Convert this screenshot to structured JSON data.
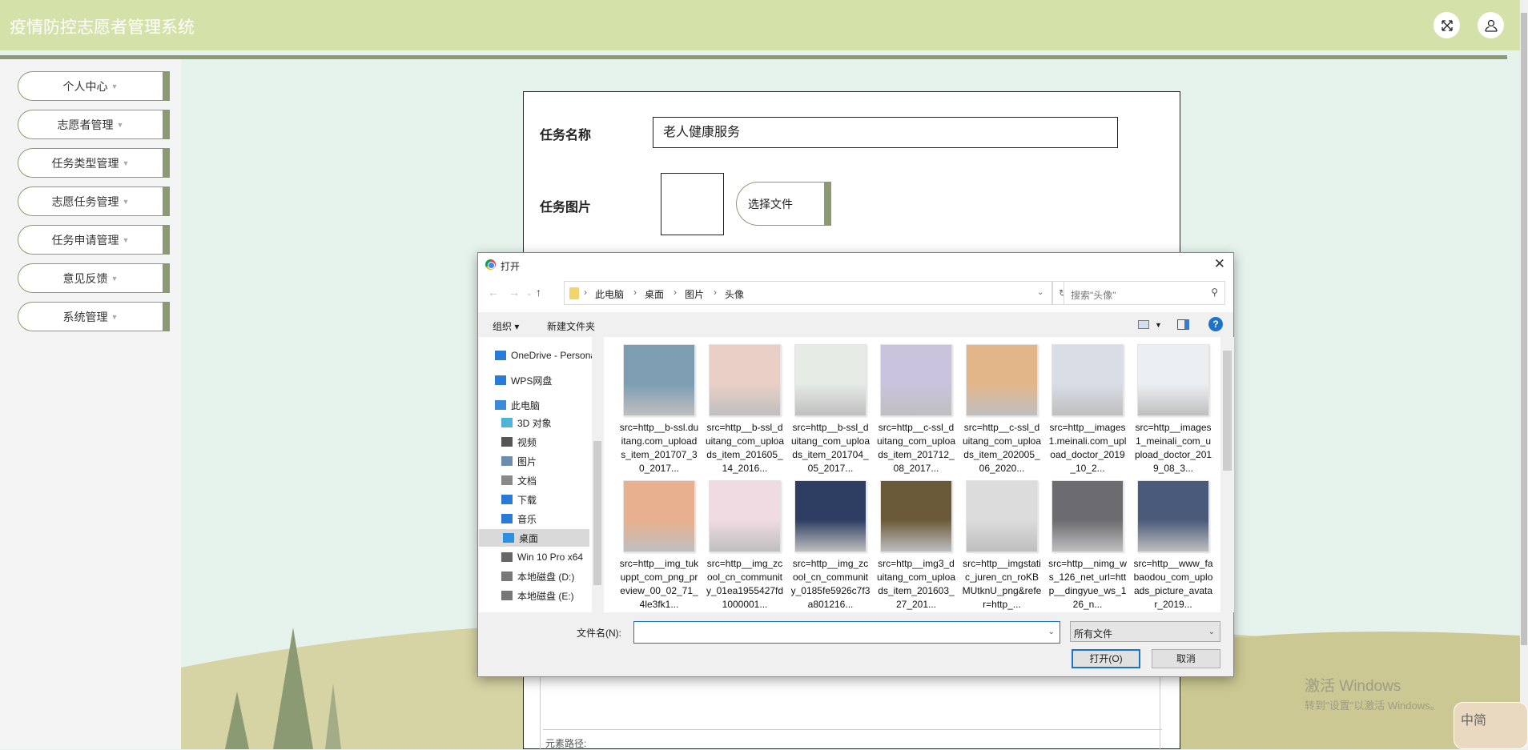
{
  "header": {
    "title": "疫情防控志愿者管理系统",
    "fullscreen_icon": "fullscreen-icon",
    "user_icon": "user-icon"
  },
  "sidebar": {
    "items": [
      {
        "label": "个人中心"
      },
      {
        "label": "志愿者管理"
      },
      {
        "label": "任务类型管理"
      },
      {
        "label": "志愿任务管理"
      },
      {
        "label": "任务申请管理"
      },
      {
        "label": "意见反馈"
      },
      {
        "label": "系统管理"
      }
    ]
  },
  "form": {
    "task_name_label": "任务名称",
    "task_name_value": "老人健康服务",
    "task_image_label": "任务图片",
    "choose_file_label": "选择文件",
    "element_path_label": "元素路径:"
  },
  "dialog": {
    "title": "打开",
    "breadcrumb": [
      "此电脑",
      "桌面",
      "图片",
      "头像"
    ],
    "search_placeholder": "搜索\"头像\"",
    "organize_label": "组织 ▾",
    "new_folder_label": "新建文件夹",
    "nav_items": [
      {
        "label": "OneDrive - Personal"
      },
      {
        "label": "WPS网盘"
      },
      {
        "label": "此电脑"
      },
      {
        "label": "3D 对象"
      },
      {
        "label": "视频"
      },
      {
        "label": "图片"
      },
      {
        "label": "文档"
      },
      {
        "label": "下载"
      },
      {
        "label": "音乐"
      },
      {
        "label": "桌面"
      },
      {
        "label": "Win 10 Pro x64"
      },
      {
        "label": "本地磁盘 (D:)"
      },
      {
        "label": "本地磁盘 (E:)"
      }
    ],
    "files": [
      {
        "name": "src=http__b-ssl.duitang.com_uploads_item_201707_30_2017...",
        "color": "#7d9db3"
      },
      {
        "name": "src=http__b-ssl_duitang_com_uploads_item_201605_14_2016...",
        "color": "#e9cfc6"
      },
      {
        "name": "src=http__b-ssl_duitang_com_uploads_item_201704_05_2017...",
        "color": "#e6ebe6"
      },
      {
        "name": "src=http__c-ssl_duitang_com_uploads_item_201712_08_2017...",
        "color": "#c9c3dd"
      },
      {
        "name": "src=http__c-ssl_duitang_com_uploads_item_202005_06_2020...",
        "color": "#e3b68a"
      },
      {
        "name": "src=http__images1.meinali.com_upload_doctor_2019_10_2...",
        "color": "#d9dde6"
      },
      {
        "name": "src=http__images1_meinali_com_upload_doctor_2019_08_3...",
        "color": "#eceff2"
      },
      {
        "name": "src=http__img_tukuppt_com_png_preview_00_02_71_4le3fk1...",
        "color": "#e8b08e"
      },
      {
        "name": "src=http__img_zcool_cn_community_01ea1955427fd1000001...",
        "color": "#f0dbe3"
      },
      {
        "name": "src=http__img_zcool_cn_community_0185fe5926c7f3a801216...",
        "color": "#2e3e63"
      },
      {
        "name": "src=http__img3_duitang_com_uploads_item_201603_27_201...",
        "color": "#6b5a3a"
      },
      {
        "name": "src=http__imgstatic_juren_cn_roKBMUtknU_png&refer=http_...",
        "color": "#dcdcdc"
      },
      {
        "name": "src=http__nimg_ws_126_net_url=http__dingyue_ws_126_n...",
        "color": "#6b6b70"
      },
      {
        "name": "src=http__www_fabaodou_com_uploads_picture_avatar_2019...",
        "color": "#4a5a7a"
      }
    ],
    "filename_label": "文件名(N):",
    "filename_value": "",
    "filter_value": "所有文件",
    "open_label": "打开(O)",
    "cancel_label": "取消"
  },
  "watermark": {
    "line1": "激活 Windows",
    "line2": "转到\"设置\"以激活 Windows。"
  },
  "ime": {
    "label": "中简"
  }
}
